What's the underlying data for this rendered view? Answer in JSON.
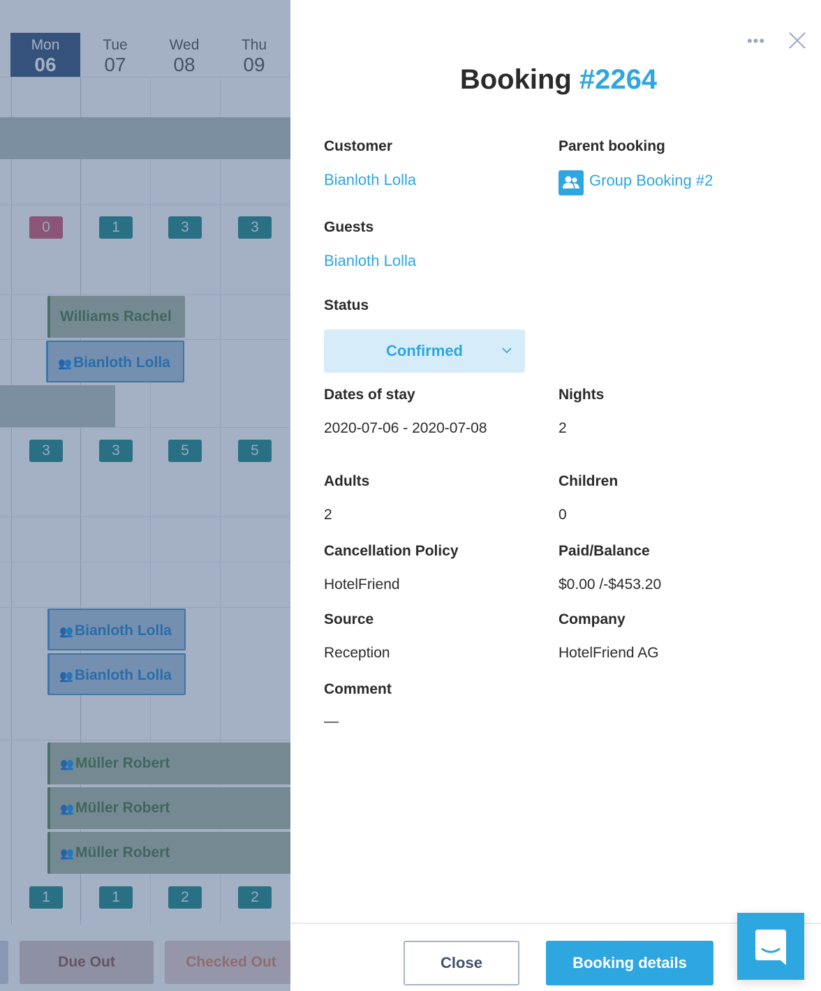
{
  "calendar": {
    "days": [
      {
        "dow": "Mon",
        "num": "06",
        "today": true
      },
      {
        "dow": "Tue",
        "num": "07"
      },
      {
        "dow": "Wed",
        "num": "08"
      },
      {
        "dow": "Thu",
        "num": "09"
      }
    ],
    "counts_row1": [
      "0",
      "1",
      "3",
      "3"
    ],
    "counts_row2": [
      "3",
      "3",
      "5",
      "5"
    ],
    "counts_row3": [
      "1",
      "1",
      "2",
      "2"
    ],
    "bookings": [
      {
        "name": "Williams Rachel",
        "type": "green",
        "group": false
      },
      {
        "name": "Bianloth Lolla",
        "type": "blue",
        "group": true
      },
      {
        "name": "Bianloth Lolla",
        "type": "blue",
        "group": true
      },
      {
        "name": "Bianloth Lolla",
        "type": "blue",
        "group": true
      },
      {
        "name": "Müller Robert",
        "type": "green",
        "group": true
      },
      {
        "name": "Müller Robert",
        "type": "green",
        "group": true
      },
      {
        "name": "Müller Robert",
        "type": "green",
        "group": true
      }
    ],
    "footer_buttons": [
      "Due Out",
      "Checked Out"
    ],
    "colors": {
      "today": "#35557f",
      "count": "#1f8a8c",
      "count_alert": "#cf5a73"
    }
  },
  "panel": {
    "title_prefix": "Booking",
    "title_number": "#2264",
    "more_icon": "more-horizontal-icon",
    "close_icon": "close-icon",
    "fields": {
      "customer": {
        "label": "Customer",
        "value": "Bianloth Lolla"
      },
      "parent_booking": {
        "label": "Parent booking",
        "value": "Group Booking #2",
        "icon": "group-icon"
      },
      "guests": {
        "label": "Guests",
        "value": "Bianloth Lolla"
      },
      "status": {
        "label": "Status",
        "value": "Confirmed"
      },
      "dates": {
        "label": "Dates of stay",
        "value": "2020-07-06 - 2020-07-08"
      },
      "nights": {
        "label": "Nights",
        "value": "2"
      },
      "adults": {
        "label": "Adults",
        "value": "2"
      },
      "children": {
        "label": "Children",
        "value": "0"
      },
      "cancellation": {
        "label": "Cancellation Policy",
        "value": "HotelFriend"
      },
      "paid_balance": {
        "label": "Paid/Balance",
        "value": "$0.00 /-$453.20"
      },
      "source": {
        "label": "Source",
        "value": "Reception"
      },
      "company": {
        "label": "Company",
        "value": "HotelFriend AG"
      },
      "comment": {
        "label": "Comment",
        "value": "—"
      }
    },
    "buttons": {
      "close": "Close",
      "details": "Booking details"
    },
    "colors": {
      "accent": "#2ea6e0",
      "status_bg": "#d6edf9"
    }
  },
  "chat_widget": {
    "icon": "chat-icon"
  }
}
